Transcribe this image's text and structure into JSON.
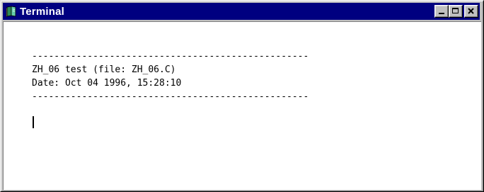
{
  "window": {
    "title": "Terminal",
    "app_icon": "terminal-book-icon",
    "controls": [
      "minimize",
      "maximize",
      "close"
    ]
  },
  "terminal": {
    "lines": [
      "--------------------------------------------------",
      "ZH_06 test (file: ZH_06.C)",
      "Date: Oct 04 1996, 15:28:10",
      "--------------------------------------------------"
    ]
  },
  "colors": {
    "titlebar": "#000080",
    "title_text": "#ffffff",
    "frame": "#c0c0c0",
    "client_bg": "#ffffff",
    "text": "#000000"
  }
}
